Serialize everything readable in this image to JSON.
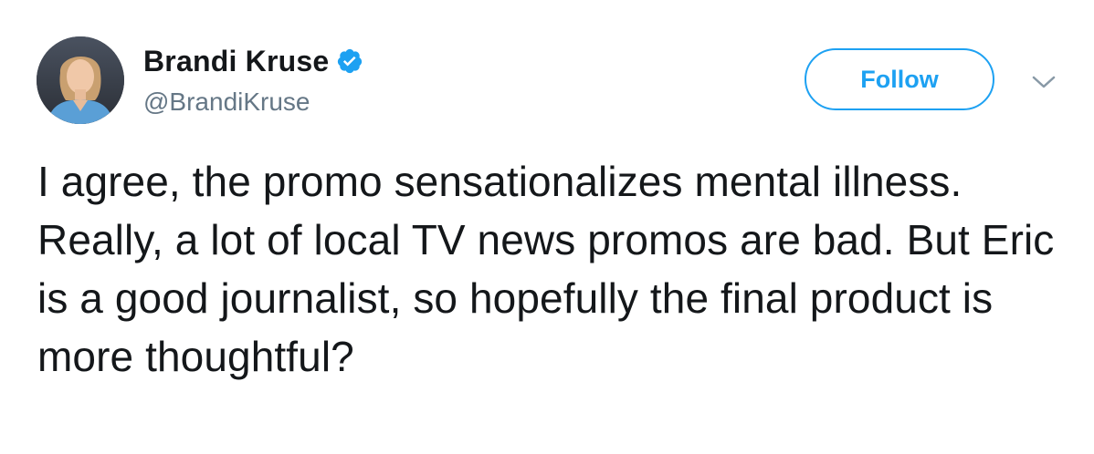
{
  "author": {
    "display_name": "Brandi Kruse",
    "handle": "@BrandiKruse",
    "verified": true,
    "avatar_icon": "profile-photo"
  },
  "actions": {
    "follow_label": "Follow",
    "more_icon": "chevron-down-icon"
  },
  "tweet": {
    "text": "I agree, the promo sensationalizes mental illness. Really, a lot of local TV news promos are bad. But Eric is a good journalist, so hopefully the final product is more thoughtful?"
  },
  "colors": {
    "accent": "#1da1f2",
    "text": "#14171a",
    "secondary_text": "#657786",
    "chevron": "#8899a6"
  }
}
